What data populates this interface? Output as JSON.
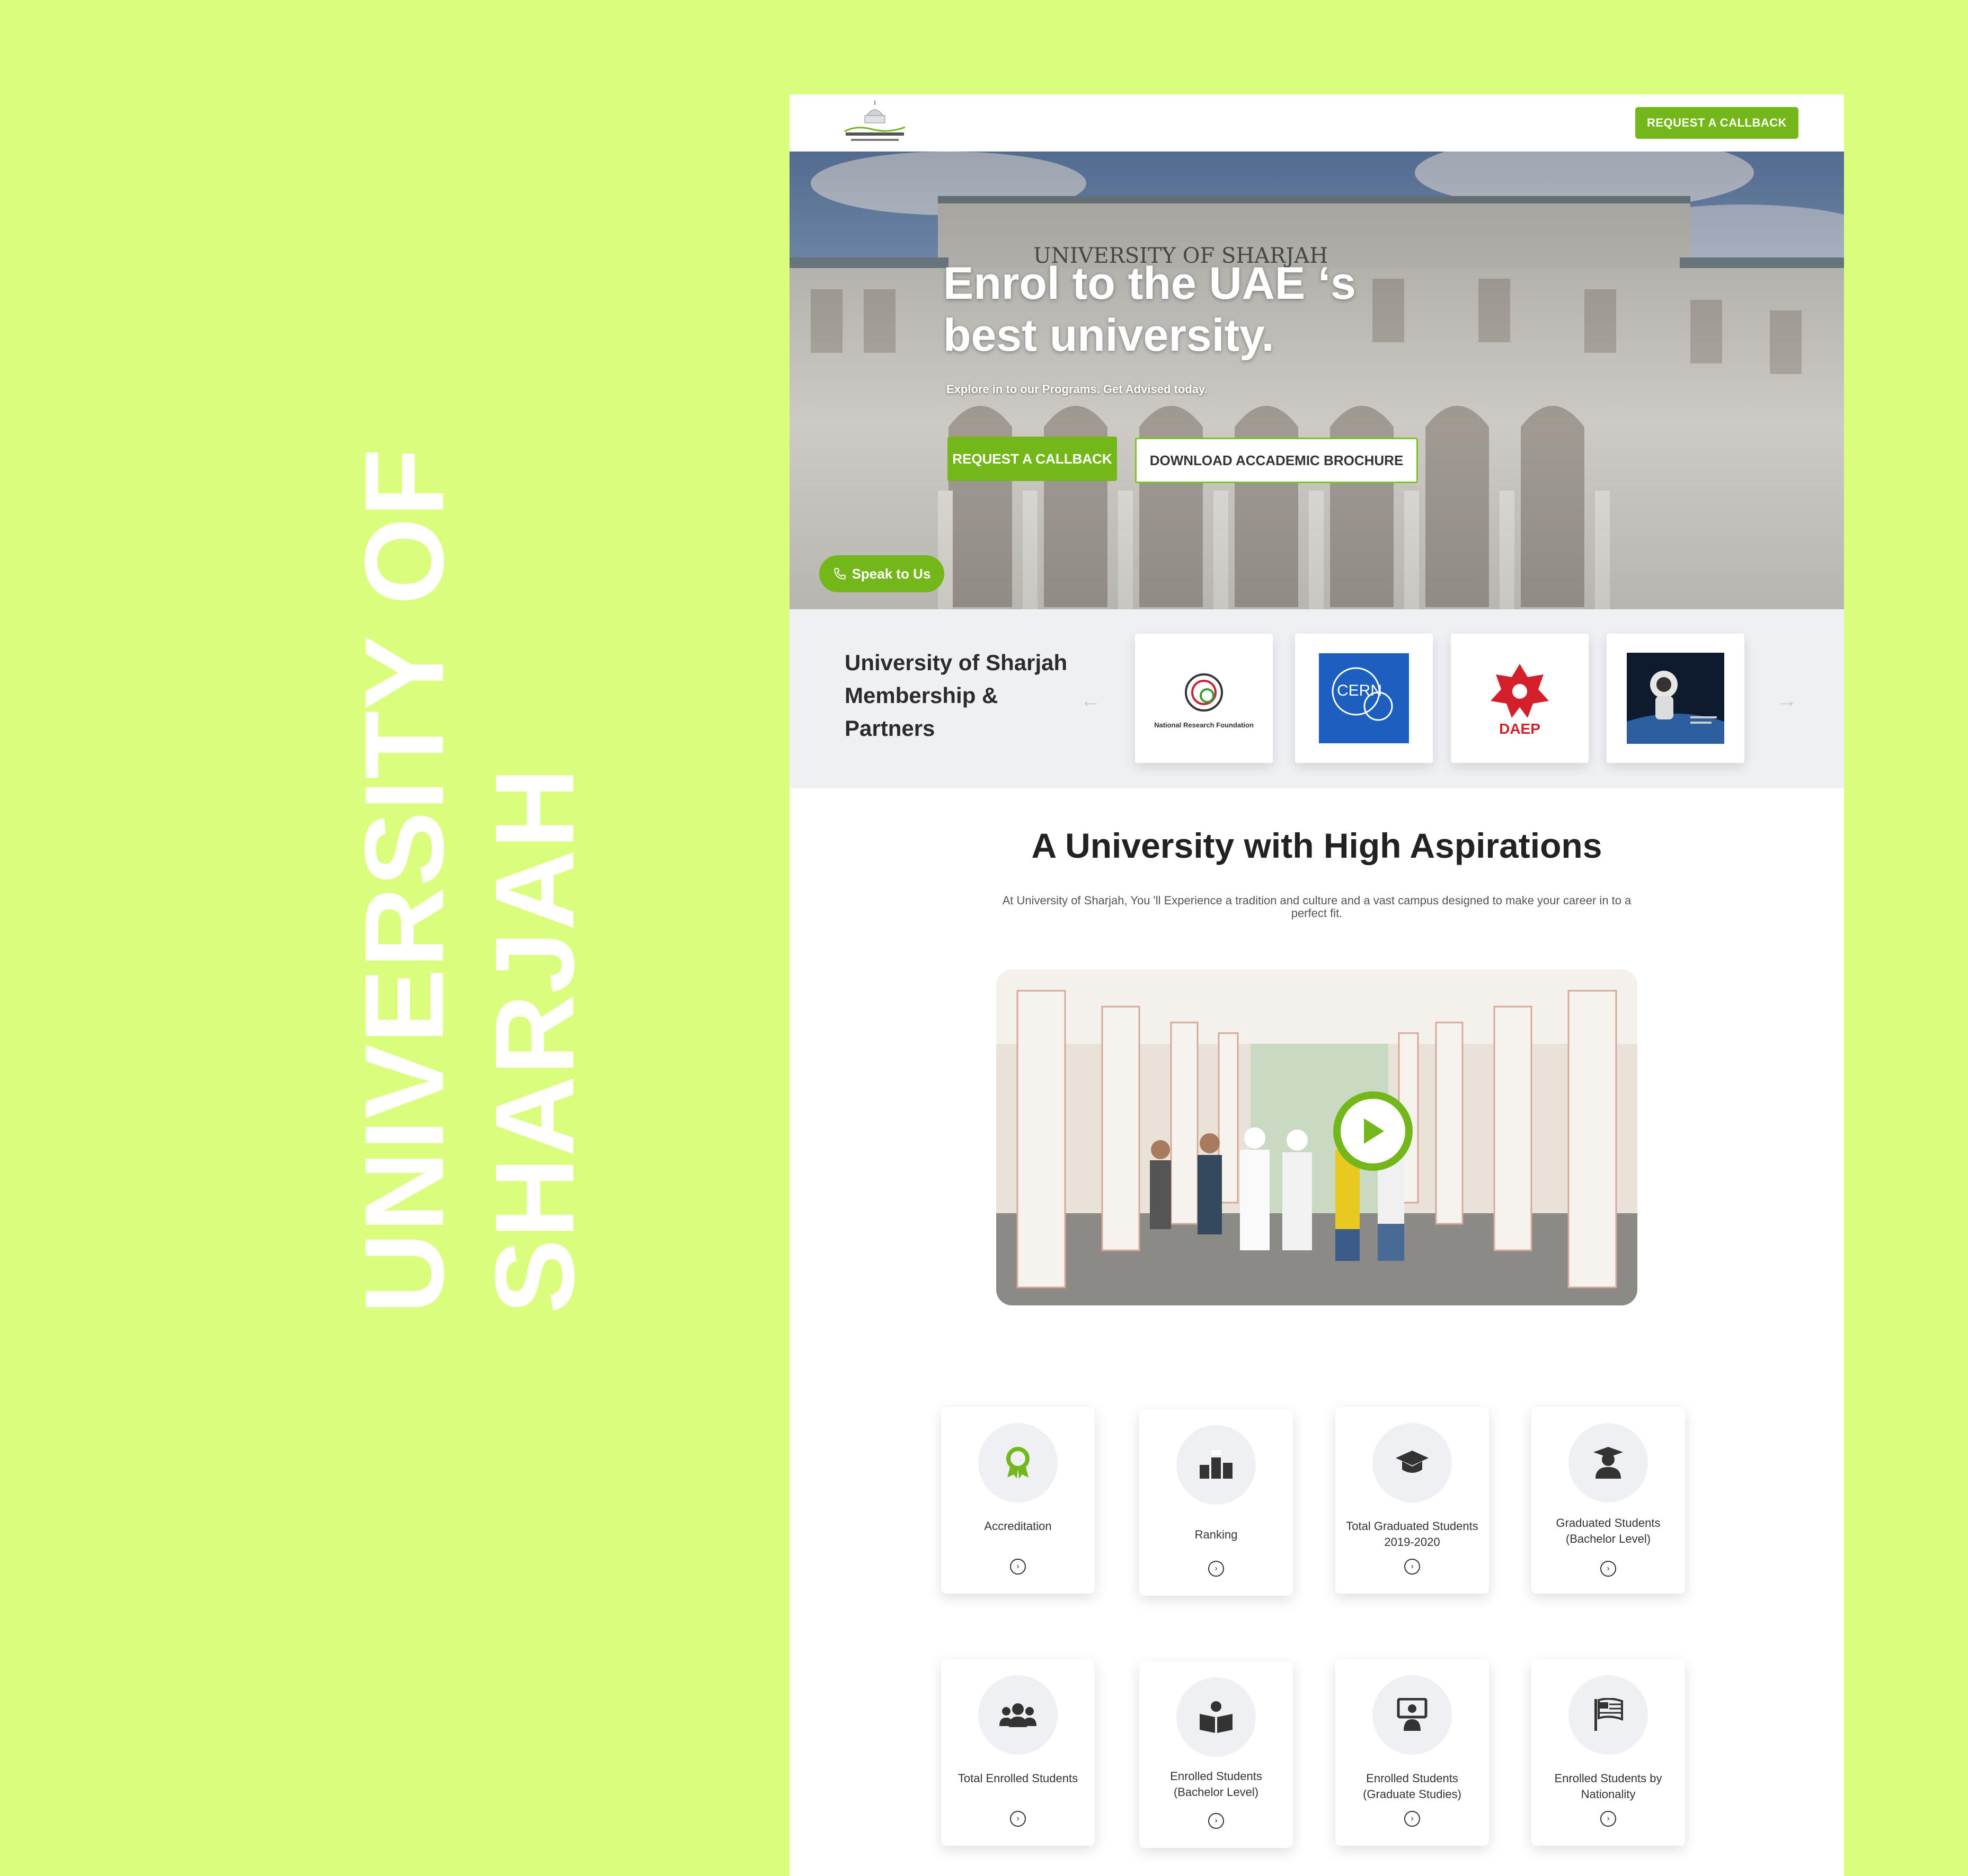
{
  "side_title": [
    "UNIVERSITY OF",
    "SHARJAH"
  ],
  "header": {
    "cta": "REQUEST A CALLBACK"
  },
  "hero": {
    "title": "Enrol to the UAE ‘s best university.",
    "subtitle": "Explore in to our Programs. Get Advised today.",
    "btn_callback": "REQUEST A CALLBACK",
    "btn_brochure": "DOWNLOAD ACCADEMIC BROCHURE",
    "speak": "Speak to Us"
  },
  "partners": {
    "title": "University of Sharjah Membership & Partners",
    "logos": [
      {
        "name": "National Research Foundation",
        "icon": "nrf-logo",
        "caption": "National Research Foundation"
      },
      {
        "name": "CERN",
        "icon": "cern-logo",
        "caption": "CERN"
      },
      {
        "name": "DAEP",
        "icon": "daep-logo",
        "caption": "DAEP"
      },
      {
        "name": "UAE Astronaut Programme",
        "icon": "astronaut-logo",
        "caption": ""
      }
    ]
  },
  "aspirations": {
    "title": "A University with High Aspirations",
    "text": "At University of Sharjah, You 'll Experience a tradition and culture and a vast campus designed to make your career in to a perfect fit."
  },
  "stats": [
    {
      "label": "Accreditation",
      "icon": "award-icon"
    },
    {
      "label": "Ranking",
      "icon": "ranking-icon"
    },
    {
      "label": "Total Graduated Students 2019-2020",
      "icon": "graduation-cap-icon"
    },
    {
      "label": "Graduated Students (Bachelor Level)",
      "icon": "graduate-user-icon"
    },
    {
      "label": "Total Enrolled Students",
      "icon": "users-icon"
    },
    {
      "label": "Enrolled Students (Bachelor Level)",
      "icon": "book-reader-icon"
    },
    {
      "label": "Enrolled Students (Graduate Studies)",
      "icon": "teacher-icon"
    },
    {
      "label": "Enrolled Students by Nationality",
      "icon": "flag-icon"
    }
  ],
  "colors": {
    "accent": "#74b71b",
    "background": "#dbfd7d"
  }
}
